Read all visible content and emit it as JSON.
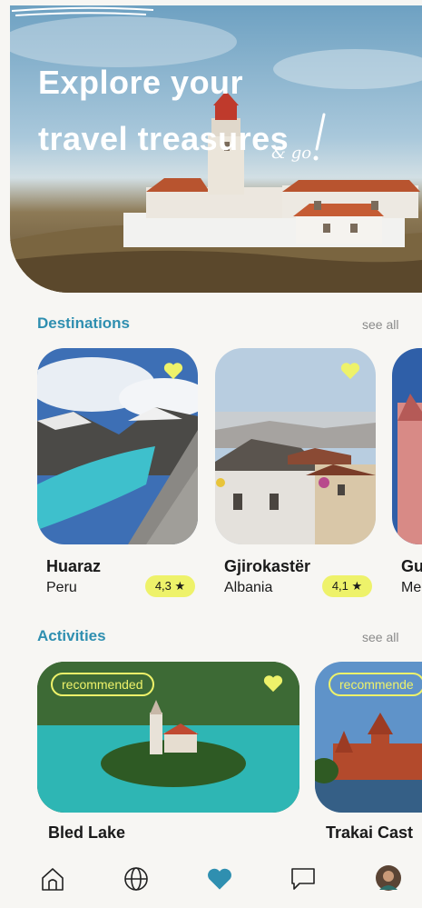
{
  "hero": {
    "title_line1": "Explore your",
    "title_line2": "travel treasures",
    "accent": "& go"
  },
  "destinations": {
    "title": "Destinations",
    "see_all": "see all",
    "items": [
      {
        "name": "Huaraz",
        "country": "Peru",
        "rating": "4,3 ★"
      },
      {
        "name": "Gjirokastër",
        "country": "Albania",
        "rating": "4,1 ★"
      },
      {
        "name": "Gu",
        "country": "Me",
        "rating": ""
      }
    ]
  },
  "activities": {
    "title": "Activities",
    "see_all": "see all",
    "items": [
      {
        "name": "Bled Lake",
        "badge": "recommended"
      },
      {
        "name": "Trakai Cast",
        "badge": "recommende"
      }
    ]
  },
  "nav": [
    "home-icon",
    "globe-icon",
    "heart-icon",
    "chat-icon",
    "avatar"
  ],
  "colors": {
    "accent": "#2f8fb0",
    "highlight": "#eef26a",
    "background": "#f7f6f3"
  }
}
